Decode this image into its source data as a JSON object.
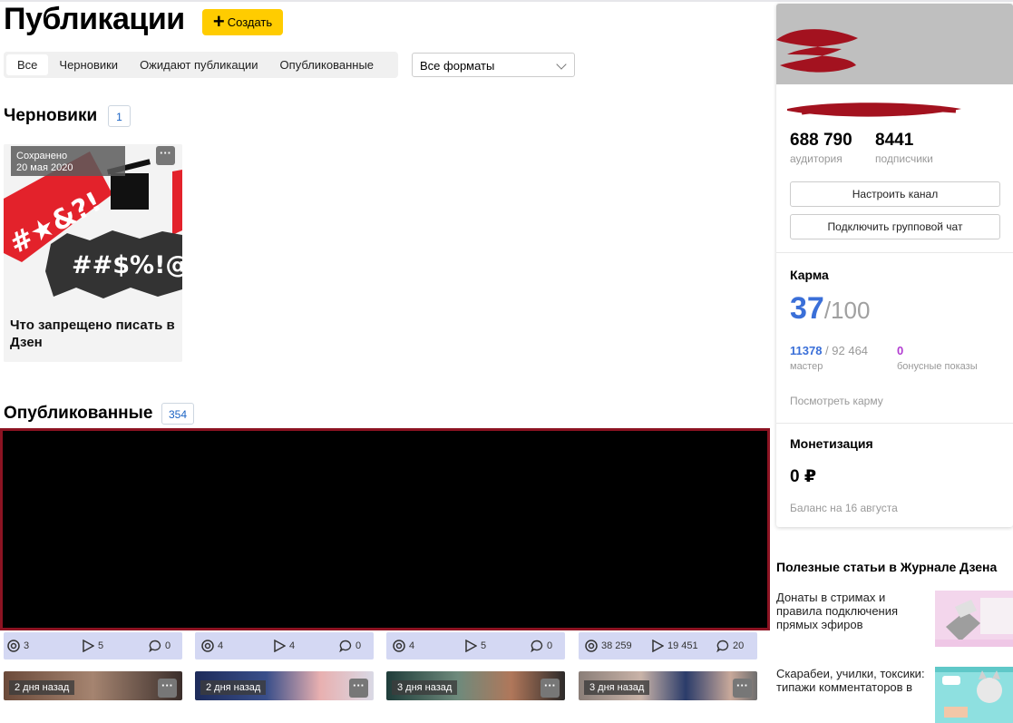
{
  "header": {
    "title": "Публикации",
    "create_label": "Создать"
  },
  "tabs": [
    {
      "label": "Все",
      "active": true
    },
    {
      "label": "Черновики"
    },
    {
      "label": "Ожидают публикации"
    },
    {
      "label": "Опубликованные"
    }
  ],
  "format_select": {
    "value": "Все форматы"
  },
  "drafts": {
    "heading": "Черновики",
    "count": "1",
    "card": {
      "saved_label": "Сохранено",
      "saved_date": "20 мая 2020",
      "title": "Что запрещено писать в Дзен",
      "menu": "···",
      "art_text": "##$%!@&"
    }
  },
  "published": {
    "heading": "Опубликованные",
    "count": "354",
    "stats": [
      {
        "views": "3",
        "reads": "5",
        "comments": "0"
      },
      {
        "views": "4",
        "reads": "4",
        "comments": "0"
      },
      {
        "views": "4",
        "reads": "5",
        "comments": "0"
      },
      {
        "views": "38 259",
        "reads": "19 451",
        "comments": "20"
      }
    ],
    "items": [
      {
        "time": "2 дня назад",
        "menu": "···"
      },
      {
        "time": "2 дня назад",
        "menu": "···"
      },
      {
        "time": "3 дня назад",
        "menu": "···"
      },
      {
        "time": "3 дня назад",
        "menu": "···"
      }
    ]
  },
  "channel": {
    "audience_value": "688 790",
    "audience_label": "аудитория",
    "subscribers_value": "8441",
    "subscribers_label": "подписчики",
    "setup_button": "Настроить канал",
    "chat_button": "Подключить групповой чат"
  },
  "karma": {
    "heading": "Карма",
    "score": "37",
    "max": "/100",
    "master_value": "11378",
    "master_total": " / 92 464",
    "master_label": "мастер",
    "bonus_value": "0",
    "bonus_label": "бонусные показы",
    "view_link": "Посмотреть карму"
  },
  "monetization": {
    "heading": "Монетизация",
    "amount": "0 ₽",
    "balance_label": "Баланс на 16 августа"
  },
  "articles": {
    "heading": "Полезные статьи в Журнале Дзена",
    "items": [
      {
        "title": "Донаты в стримах и правила подключения прямых эфиров"
      },
      {
        "title": "Скарабеи, училки, токсики: типажи комментаторов в"
      }
    ]
  },
  "colors": {
    "accent_yellow": "#ffcc00",
    "link_blue": "#1a63c4",
    "karma_blue": "#3a6fd8",
    "bonus_purple": "#b13bd1",
    "redaction_border": "#8c1322"
  }
}
